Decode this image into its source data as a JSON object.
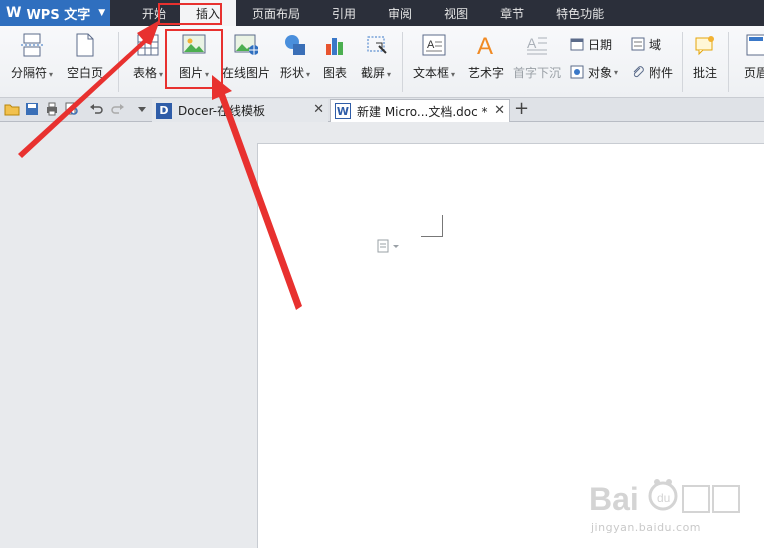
{
  "app": {
    "name": "WPS 文字"
  },
  "menu": {
    "tabs": [
      "开始",
      "插入",
      "页面布局",
      "引用",
      "审阅",
      "视图",
      "章节",
      "特色功能"
    ],
    "active": "插入"
  },
  "ribbon": {
    "page_break": "分隔符",
    "blank_page": "空白页",
    "table": "表格",
    "picture": "图片",
    "online_picture": "在线图片",
    "shapes": "形状",
    "chart": "图表",
    "screenshot": "截屏",
    "textbox": "文本框",
    "wordart": "艺术字",
    "drop_cap": "首字下沉",
    "date": "日期",
    "object": "对象",
    "field": "域",
    "attachment": "附件",
    "comment": "批注",
    "header_footer": "页眉"
  },
  "tabs": {
    "docer": "Docer-在线模板",
    "doc": "新建 Micro...文档.doc *"
  },
  "watermark": {
    "url": "jingyan.baidu.com"
  },
  "colors": {
    "accent": "#2f6fbf",
    "highlight": "#e8312f",
    "menubar": "#2b2f3a"
  }
}
